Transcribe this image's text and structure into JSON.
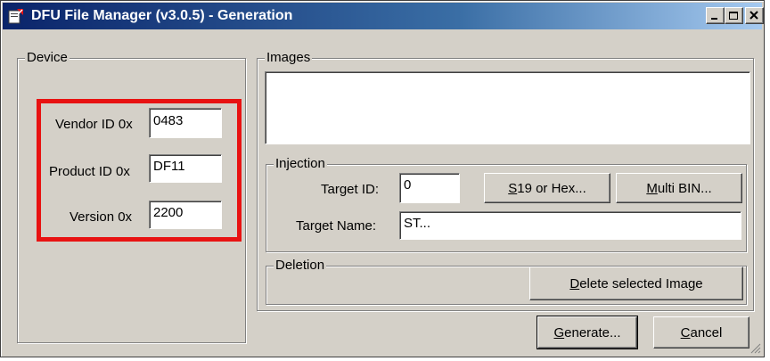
{
  "window": {
    "title": "DFU File Manager (v3.0.5) - Generation",
    "controls": [
      "minimize-icon",
      "maximize-icon",
      "close-icon"
    ]
  },
  "device": {
    "group_label": "Device",
    "vendor_label": "Vendor ID 0x",
    "vendor_value": "0483",
    "product_label": "Product ID 0x",
    "product_value": "DF11",
    "version_label": "Version 0x",
    "version_value": "2200",
    "highlight_color": "#e81212"
  },
  "images": {
    "group_label": "Images"
  },
  "injection": {
    "group_label": "Injection",
    "target_id_label": "Target ID:",
    "target_id_value": "0",
    "s19_button_prefix": "",
    "s19_button_underline": "S",
    "s19_button_rest": "19 or Hex...",
    "multibin_button_prefix": "",
    "multibin_button_underline": "M",
    "multibin_button_rest": "ulti BIN...",
    "target_name_label": "Target Name:",
    "target_name_value": "ST..."
  },
  "deletion": {
    "group_label": "Deletion",
    "delete_button_underline": "D",
    "delete_button_rest": "elete selected Image"
  },
  "footer": {
    "generate_underline": "G",
    "generate_rest": "enerate...",
    "cancel_underline": "C",
    "cancel_rest": "ancel"
  },
  "colors": {
    "titlebar_start": "#0a246a",
    "titlebar_end": "#a6caf0",
    "face": "#d4d0c8"
  }
}
